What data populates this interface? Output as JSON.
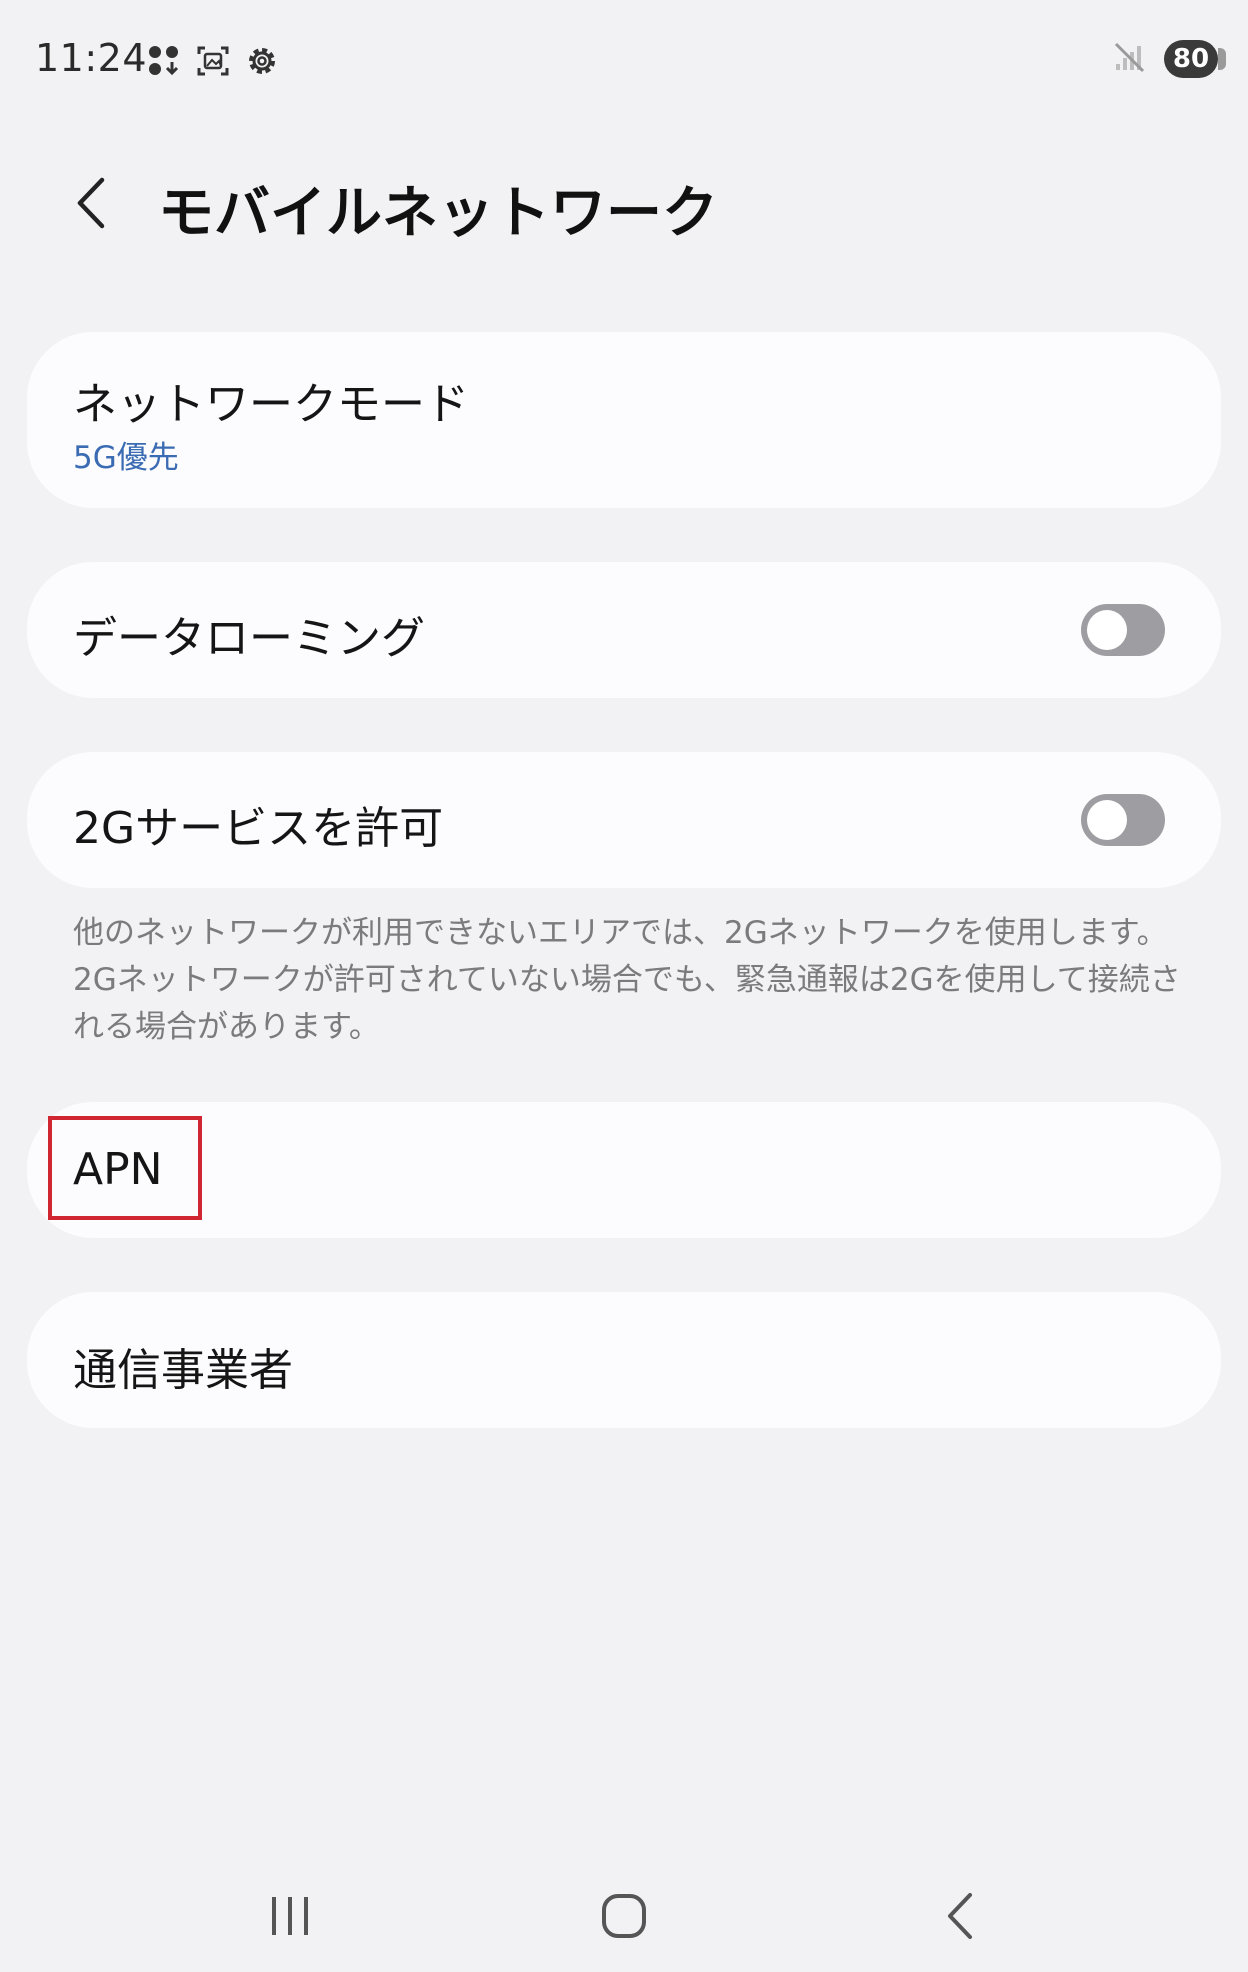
{
  "status_bar": {
    "time": "11:24",
    "battery": "80",
    "icons_left": [
      "app-grid-icon",
      "screenshot-icon",
      "settings-gear-icon"
    ],
    "icons_right": [
      "no-signal-icon",
      "battery-icon"
    ]
  },
  "header": {
    "title": "モバイルネットワーク",
    "back_icon": "chevron-left-icon"
  },
  "items": {
    "network_mode": {
      "label": "ネットワークモード",
      "value": "5G優先"
    },
    "data_roaming": {
      "label": "データローミング",
      "enabled": false
    },
    "allow_2g": {
      "label": "2Gサービスを許可",
      "enabled": false,
      "note": "他のネットワークが利用できないエリアでは、2Gネットワークを使用します。2Gネットワークが許可されていない場合でも、緊急通報は2Gを使用して接続される場合があります。"
    },
    "apn": {
      "label": "APN"
    },
    "carrier": {
      "label": "通信事業者"
    }
  },
  "colors": {
    "background": "#f2f2f4",
    "card": "#fcfcfe",
    "accent_value": "#3b6cb3",
    "toggle_off": "#9e9ea2",
    "highlight": "#d02632"
  },
  "nav_bar": {
    "recents_icon": "recents-icon",
    "home_icon": "home-icon",
    "back_icon": "back-nav-icon"
  }
}
